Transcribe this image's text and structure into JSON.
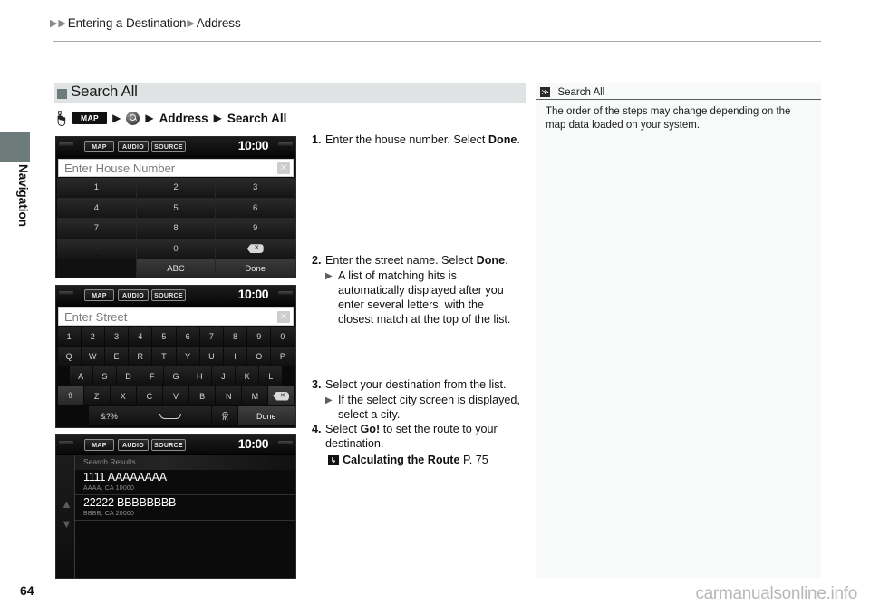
{
  "breadcrumb": {
    "item1": "Entering a Destination",
    "item2": "Address"
  },
  "side_tab": {
    "label": "Navigation"
  },
  "section": {
    "title": "Search All"
  },
  "path_row": {
    "hand_icon": "hand-press-icon",
    "map_button": "MAP",
    "search_icon": "magnifier-icon",
    "step_address": "Address",
    "step_search_all": "Search All"
  },
  "device1": {
    "topbar": {
      "map": "MAP",
      "audio": "AUDIO",
      "source": "SOURCE",
      "clock": "10:00"
    },
    "field_placeholder": "Enter House Number",
    "clear_icon": "✕",
    "keys": [
      [
        "1",
        "2",
        "3"
      ],
      [
        "4",
        "5",
        "6"
      ],
      [
        "7",
        "8",
        "9"
      ],
      [
        "-",
        "0",
        "backspace"
      ],
      [
        "",
        "ABC",
        "Done"
      ]
    ]
  },
  "device2": {
    "topbar": {
      "map": "MAP",
      "audio": "AUDIO",
      "source": "SOURCE",
      "clock": "10:00"
    },
    "field_placeholder": "Enter Street",
    "clear_icon": "✕",
    "row_numbers": [
      "1",
      "2",
      "3",
      "4",
      "5",
      "6",
      "7",
      "8",
      "9",
      "0"
    ],
    "row_q": [
      "Q",
      "W",
      "E",
      "R",
      "T",
      "Y",
      "U",
      "I",
      "O",
      "P"
    ],
    "row_a": [
      "A",
      "S",
      "D",
      "F",
      "G",
      "H",
      "J",
      "K",
      "L"
    ],
    "row_z": [
      "Z",
      "X",
      "C",
      "V",
      "B",
      "N",
      "M"
    ],
    "shift_label": "⇧",
    "backspace_label": "⌧",
    "symbols_label": "&?%",
    "mic_label": "mic-icon",
    "done_label": "Done"
  },
  "device3": {
    "topbar": {
      "map": "MAP",
      "audio": "AUDIO",
      "source": "SOURCE",
      "clock": "10:00"
    },
    "list_title": "Search Results",
    "results": [
      {
        "name": "1111 AAAAAAAA",
        "sub": "AAAA, CA 10000"
      },
      {
        "name": "22222 BBBBBBBB",
        "sub": "BBBB, CA 20000"
      }
    ],
    "scroll_up": "▲",
    "scroll_down": "▼"
  },
  "steps": {
    "s1_num": "1.",
    "s1_text_a": "Enter the house number. Select ",
    "s1_bold": "Done",
    "s1_text_b": ".",
    "s2_num": "2.",
    "s2_text_a": "Enter the street name. Select ",
    "s2_bold": "Done",
    "s2_text_b": ".",
    "s2_sub": "A list of matching hits is automatically displayed after you enter several letters, with the closest match at the top of the list.",
    "s3_num": "3.",
    "s3_text": "Select your destination from the list.",
    "s3_sub": "If the select city screen is displayed, select a city.",
    "s4_num": "4.",
    "s4_text_a": "Select ",
    "s4_bold": "Go!",
    "s4_text_b": " to set the route to your destination.",
    "ref_icon": "↳",
    "ref_title": "Calculating the Route",
    "ref_page": " P. 75"
  },
  "note": {
    "icon": "≫",
    "title": "Search All",
    "body": "The order of the steps may change depending on the map data loaded on your system."
  },
  "footer": {
    "page_number": "64",
    "watermark": "carmanualsonline.info"
  },
  "colors": {
    "accent": "#6d7b7b",
    "band": "#dfe3e3",
    "note_panel": "#f8fafa",
    "screen_black": "#0a0a0a"
  }
}
